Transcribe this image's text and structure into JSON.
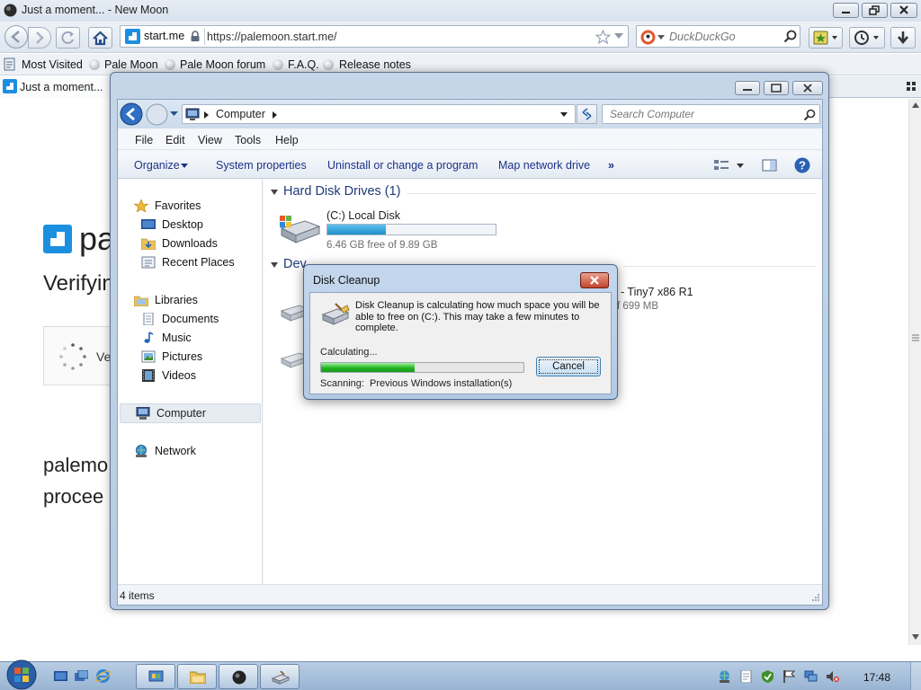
{
  "browser": {
    "title": "Just a moment... - New Moon",
    "url": "https://palemoon.start.me/",
    "identity_label": "start.me",
    "search_placeholder": "DuckDuckGo",
    "bookmarks": [
      "Most Visited",
      "Pale Moon",
      "Pale Moon forum",
      "F.A.Q.",
      "Release notes"
    ],
    "tab_title": "Just a moment..."
  },
  "webpage": {
    "logo_text": "pa",
    "heading_partial": "Verifyin",
    "box_text_partial": "Ve",
    "paragraph_line1": "palemo",
    "paragraph_line2": "procee"
  },
  "explorer": {
    "breadcrumb": "Computer",
    "search_placeholder": "Search Computer",
    "menu": [
      "File",
      "Edit",
      "View",
      "Tools",
      "Help"
    ],
    "commands": [
      "Organize",
      "System properties",
      "Uninstall or change a program",
      "Map network drive"
    ],
    "more_glyph": "»",
    "nav": {
      "favorites": "Favorites",
      "desktop": "Desktop",
      "downloads": "Downloads",
      "recent_places": "Recent Places",
      "libraries": "Libraries",
      "documents": "Documents",
      "music": "Music",
      "pictures": "Pictures",
      "videos": "Videos",
      "computer": "Computer",
      "network": "Network"
    },
    "section_hdd": "Hard Disk Drives (1)",
    "section_dev_partial": "Dev",
    "local_disk": {
      "name": "(C:) Local Disk",
      "free_text": "6.46 GB free of 9.89 GB",
      "used_fraction": 0.35
    },
    "removable_partial": "- Tiny7 x86 R1",
    "removable_size_partial": "f 699 MB",
    "status_text": "4 items"
  },
  "dialog": {
    "title": "Disk Cleanup",
    "message": "Disk Cleanup is calculating how much space you will be able to free on  (C:). This may take a few minutes to complete.",
    "calculating": "Calculating...",
    "cancel": "Cancel",
    "scanning_label": "Scanning:",
    "scanning_item": "Previous Windows installation(s)",
    "progress_fraction": 0.46
  },
  "taskbar": {
    "clock": "17:48"
  },
  "colors": {
    "accent_blue": "#1e90ff",
    "progress_green": "#22b522",
    "disk_bar_blue": "#1e8fc7"
  }
}
